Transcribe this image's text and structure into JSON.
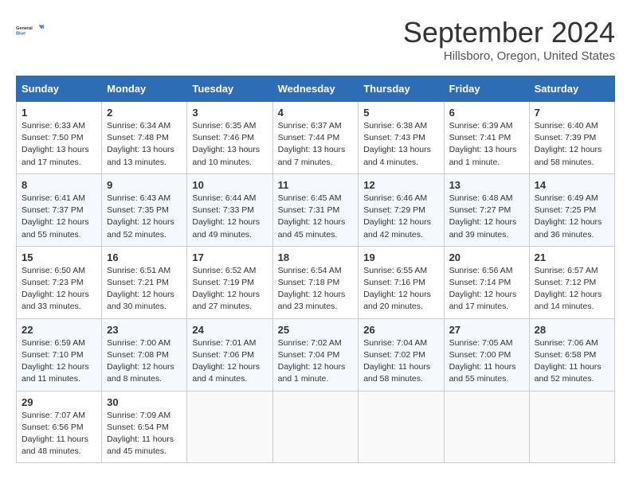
{
  "header": {
    "logo_line1": "General",
    "logo_line2": "Blue",
    "month": "September 2024",
    "location": "Hillsboro, Oregon, United States"
  },
  "weekdays": [
    "Sunday",
    "Monday",
    "Tuesday",
    "Wednesday",
    "Thursday",
    "Friday",
    "Saturday"
  ],
  "weeks": [
    [
      {
        "day": "1",
        "sunrise": "6:33 AM",
        "sunset": "7:50 PM",
        "daylight": "13 hours and 17 minutes."
      },
      {
        "day": "2",
        "sunrise": "6:34 AM",
        "sunset": "7:48 PM",
        "daylight": "13 hours and 13 minutes."
      },
      {
        "day": "3",
        "sunrise": "6:35 AM",
        "sunset": "7:46 PM",
        "daylight": "13 hours and 10 minutes."
      },
      {
        "day": "4",
        "sunrise": "6:37 AM",
        "sunset": "7:44 PM",
        "daylight": "13 hours and 7 minutes."
      },
      {
        "day": "5",
        "sunrise": "6:38 AM",
        "sunset": "7:43 PM",
        "daylight": "13 hours and 4 minutes."
      },
      {
        "day": "6",
        "sunrise": "6:39 AM",
        "sunset": "7:41 PM",
        "daylight": "13 hours and 1 minute."
      },
      {
        "day": "7",
        "sunrise": "6:40 AM",
        "sunset": "7:39 PM",
        "daylight": "12 hours and 58 minutes."
      }
    ],
    [
      {
        "day": "8",
        "sunrise": "6:41 AM",
        "sunset": "7:37 PM",
        "daylight": "12 hours and 55 minutes."
      },
      {
        "day": "9",
        "sunrise": "6:43 AM",
        "sunset": "7:35 PM",
        "daylight": "12 hours and 52 minutes."
      },
      {
        "day": "10",
        "sunrise": "6:44 AM",
        "sunset": "7:33 PM",
        "daylight": "12 hours and 49 minutes."
      },
      {
        "day": "11",
        "sunrise": "6:45 AM",
        "sunset": "7:31 PM",
        "daylight": "12 hours and 45 minutes."
      },
      {
        "day": "12",
        "sunrise": "6:46 AM",
        "sunset": "7:29 PM",
        "daylight": "12 hours and 42 minutes."
      },
      {
        "day": "13",
        "sunrise": "6:48 AM",
        "sunset": "7:27 PM",
        "daylight": "12 hours and 39 minutes."
      },
      {
        "day": "14",
        "sunrise": "6:49 AM",
        "sunset": "7:25 PM",
        "daylight": "12 hours and 36 minutes."
      }
    ],
    [
      {
        "day": "15",
        "sunrise": "6:50 AM",
        "sunset": "7:23 PM",
        "daylight": "12 hours and 33 minutes."
      },
      {
        "day": "16",
        "sunrise": "6:51 AM",
        "sunset": "7:21 PM",
        "daylight": "12 hours and 30 minutes."
      },
      {
        "day": "17",
        "sunrise": "6:52 AM",
        "sunset": "7:19 PM",
        "daylight": "12 hours and 27 minutes."
      },
      {
        "day": "18",
        "sunrise": "6:54 AM",
        "sunset": "7:18 PM",
        "daylight": "12 hours and 23 minutes."
      },
      {
        "day": "19",
        "sunrise": "6:55 AM",
        "sunset": "7:16 PM",
        "daylight": "12 hours and 20 minutes."
      },
      {
        "day": "20",
        "sunrise": "6:56 AM",
        "sunset": "7:14 PM",
        "daylight": "12 hours and 17 minutes."
      },
      {
        "day": "21",
        "sunrise": "6:57 AM",
        "sunset": "7:12 PM",
        "daylight": "12 hours and 14 minutes."
      }
    ],
    [
      {
        "day": "22",
        "sunrise": "6:59 AM",
        "sunset": "7:10 PM",
        "daylight": "12 hours and 11 minutes."
      },
      {
        "day": "23",
        "sunrise": "7:00 AM",
        "sunset": "7:08 PM",
        "daylight": "12 hours and 8 minutes."
      },
      {
        "day": "24",
        "sunrise": "7:01 AM",
        "sunset": "7:06 PM",
        "daylight": "12 hours and 4 minutes."
      },
      {
        "day": "25",
        "sunrise": "7:02 AM",
        "sunset": "7:04 PM",
        "daylight": "12 hours and 1 minute."
      },
      {
        "day": "26",
        "sunrise": "7:04 AM",
        "sunset": "7:02 PM",
        "daylight": "11 hours and 58 minutes."
      },
      {
        "day": "27",
        "sunrise": "7:05 AM",
        "sunset": "7:00 PM",
        "daylight": "11 hours and 55 minutes."
      },
      {
        "day": "28",
        "sunrise": "7:06 AM",
        "sunset": "6:58 PM",
        "daylight": "11 hours and 52 minutes."
      }
    ],
    [
      {
        "day": "29",
        "sunrise": "7:07 AM",
        "sunset": "6:56 PM",
        "daylight": "11 hours and 48 minutes."
      },
      {
        "day": "30",
        "sunrise": "7:09 AM",
        "sunset": "6:54 PM",
        "daylight": "11 hours and 45 minutes."
      },
      null,
      null,
      null,
      null,
      null
    ]
  ]
}
